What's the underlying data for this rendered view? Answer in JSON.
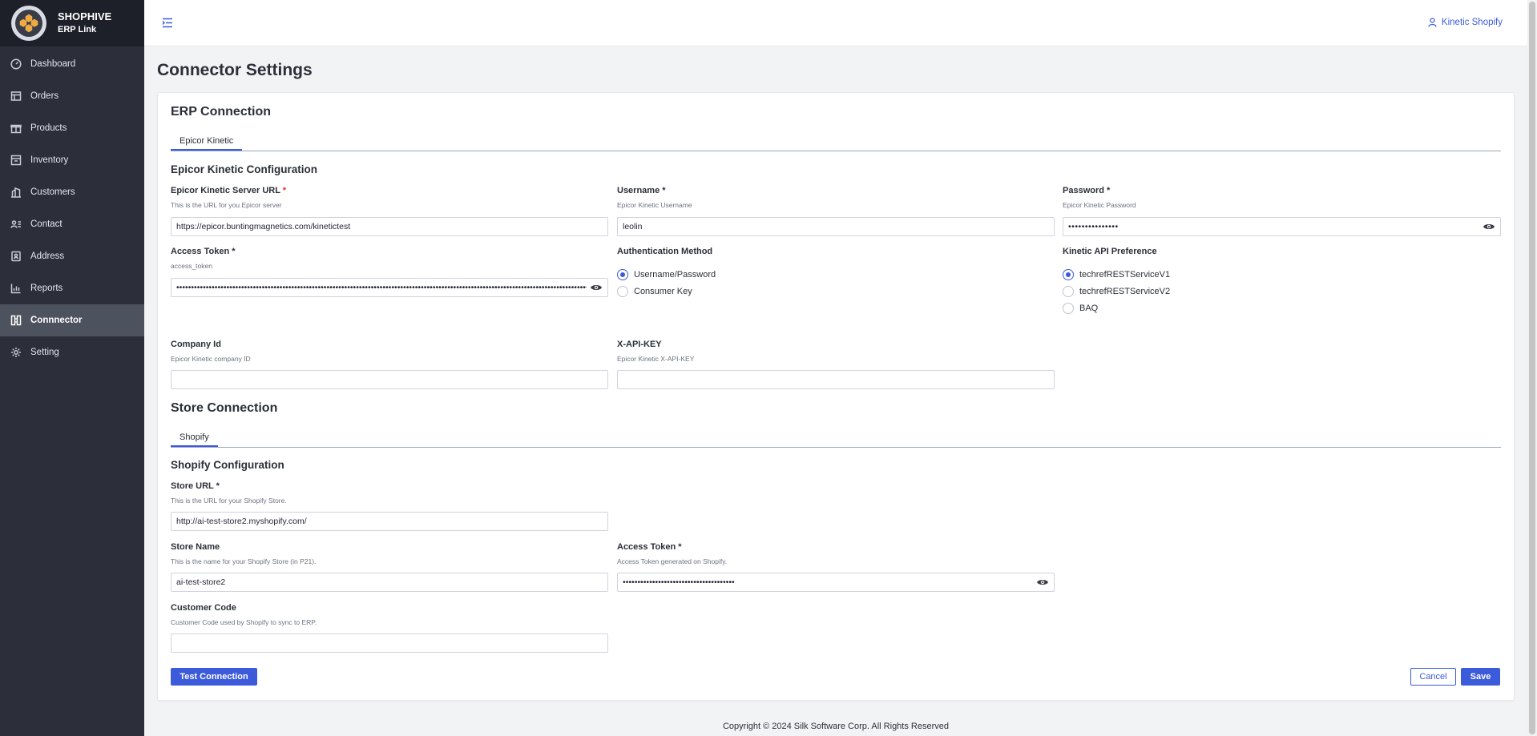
{
  "brand": {
    "name": "SHOPHIVE",
    "subtitle": "ERP Link"
  },
  "sidebar": {
    "items": [
      {
        "label": "Dashboard",
        "icon": "gauge-icon"
      },
      {
        "label": "Orders",
        "icon": "orders-icon"
      },
      {
        "label": "Products",
        "icon": "gift-icon"
      },
      {
        "label": "Inventory",
        "icon": "archive-icon"
      },
      {
        "label": "Customers",
        "icon": "building-icon"
      },
      {
        "label": "Contact",
        "icon": "contact-card-icon"
      },
      {
        "label": "Address",
        "icon": "address-book-icon"
      },
      {
        "label": "Reports",
        "icon": "bar-chart-icon"
      },
      {
        "label": "Connnector",
        "icon": "connector-icon",
        "active": true
      },
      {
        "label": "Setting",
        "icon": "gear-icon"
      }
    ]
  },
  "topbar": {
    "user_label": "Kinetic Shopify"
  },
  "page": {
    "title": "Connector Settings"
  },
  "erp": {
    "heading": "ERP Connection",
    "tab": "Epicor Kinetic",
    "config_title": "Epicor Kinetic Configuration",
    "server_url": {
      "label": "Epicor Kinetic Server URL ",
      "required": "*",
      "hint": "This is the URL for you Epicor server",
      "value": "https://epicor.buntingmagnetics.com/kinetictest"
    },
    "username": {
      "label": "Username *",
      "hint": "Epicor Kinetic Username",
      "value": "leolin"
    },
    "password": {
      "label": "Password *",
      "hint": "Epicor Kinetic Password",
      "value": "•••••••••••••••"
    },
    "access_token": {
      "label": "Access Token *",
      "hint": "access_token",
      "value": "•••••••••••••••••••••••••••••••••••••••••••••••••••••••••••••••••••••••••••••••••••••••••••••••••••••••••••••••••••••••••••••••••••••••••••••"
    },
    "auth_method": {
      "label": "Authentication Method",
      "options": [
        "Username/Password",
        "Consumer Key"
      ],
      "selected": "Username/Password"
    },
    "api_pref": {
      "label": "Kinetic API Preference",
      "options": [
        "techrefRESTServiceV1",
        "techrefRESTServiceV2",
        "BAQ"
      ],
      "selected": "techrefRESTServiceV1"
    },
    "company_id": {
      "label": "Company Id",
      "hint": "Epicor Kinetic company ID",
      "value": ""
    },
    "x_api_key": {
      "label": "X-API-KEY",
      "hint": "Epicor Kinetic X-API-KEY",
      "value": ""
    }
  },
  "store": {
    "heading": "Store Connection",
    "tab": "Shopify",
    "config_title": "Shopify Configuration",
    "store_url": {
      "label": "Store URL *",
      "hint": "This is the URL for your Shopify Store.",
      "value": "http://ai-test-store2.myshopify.com/"
    },
    "store_name": {
      "label": "Store Name",
      "hint": "This is the name for your Shopify Store (in P21).",
      "value": "ai-test-store2"
    },
    "access_token": {
      "label": "Access Token *",
      "hint": "Access Token generated on Shopify.",
      "value": "••••••••••••••••••••••••••••••••••••••"
    },
    "customer_code": {
      "label": "Customer Code",
      "hint": "Customer Code used by Shopify to sync to ERP.",
      "value": ""
    }
  },
  "actions": {
    "test": "Test Connection",
    "cancel": "Cancel",
    "save": "Save"
  },
  "footer": {
    "text": "Copyright © 2024 Silk Software Corp. All Rights Reserved"
  },
  "colors": {
    "accent": "#3b5bdb",
    "sidebar_bg": "#2c2f3a",
    "sidebar_active": "#4d525f",
    "required": "#e03131"
  }
}
